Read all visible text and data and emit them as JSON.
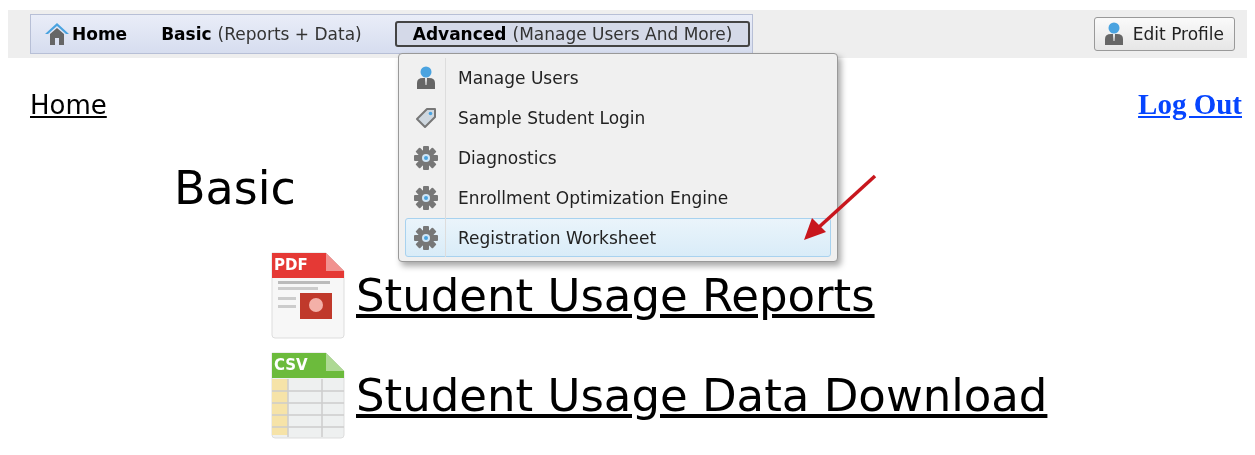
{
  "nav": {
    "items": [
      {
        "kind": "home",
        "bold": "Home",
        "selected": false
      },
      {
        "kind": "text",
        "bold": "Basic",
        "rest": "(Reports + Data)",
        "selected": false
      },
      {
        "kind": "text",
        "bold": "Advanced",
        "rest": "(Manage Users And More)",
        "selected": true
      }
    ],
    "profile_button": "Edit Profile"
  },
  "menu": {
    "items": [
      {
        "kind": "user",
        "label": "Manage Users",
        "selected": false
      },
      {
        "kind": "tag",
        "label": "Sample Student Login",
        "selected": false
      },
      {
        "kind": "gear",
        "label": "Diagnostics",
        "selected": false
      },
      {
        "kind": "gear",
        "label": "Enrollment Optimization Engine",
        "selected": false
      },
      {
        "kind": "gear",
        "label": "Registration Worksheet",
        "selected": true
      }
    ]
  },
  "breadcrumb": "Home",
  "logout": "Log Out",
  "heading": "Basic",
  "links": [
    {
      "kind": "pdf",
      "badge": "PDF",
      "label": "Student Usage Reports"
    },
    {
      "kind": "csv",
      "badge": "CSV",
      "label": "Student Usage Data Download"
    }
  ]
}
